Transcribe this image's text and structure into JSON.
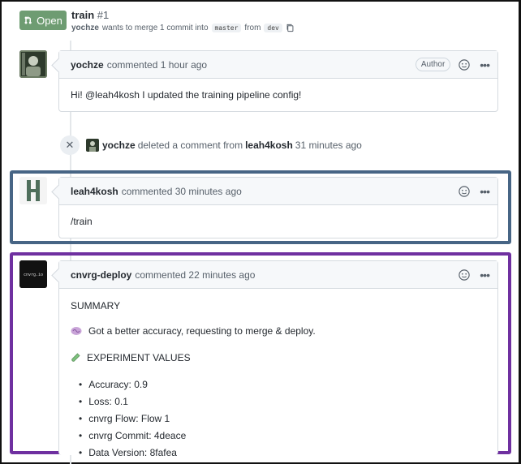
{
  "pr": {
    "status": "Open",
    "title": "train",
    "number": "#1",
    "author": "yochze",
    "merge_text": "wants to merge 1 commit into",
    "base_branch": "master",
    "from_text": "from",
    "head_branch": "dev"
  },
  "comments": [
    {
      "author": "yochze",
      "meta": "commented 1 hour ago",
      "badge": "Author",
      "body": "Hi! @leah4kosh I updated the training pipeline config!"
    },
    {
      "author": "leah4kosh",
      "meta": "commented 30 minutes ago",
      "body": "/train"
    },
    {
      "author": "cnvrg-deploy",
      "meta": "commented 22 minutes ago",
      "avatar_text": "cnvrg.io",
      "summary": "SUMMARY",
      "accuracy_line": "Got a better accuracy, requesting to merge & deploy.",
      "experiment_heading": "EXPERIMENT VALUES",
      "values": [
        "Accuracy: 0.9",
        "Loss: 0.1",
        "cnvrg Flow: Flow 1",
        "cnvrg Commit: 4deace",
        "Data Version: 8fafea"
      ]
    }
  ],
  "event": {
    "actor": "yochze",
    "text1": "deleted a comment from",
    "target": "leah4kosh",
    "time": "31 minutes ago"
  },
  "colors": {
    "open_badge": "#6e9c72",
    "highlight_blue": "#476585",
    "highlight_purple": "#6f30a0"
  },
  "icons": [
    "pull-request-icon",
    "copy-icon",
    "smiley-icon",
    "more-icon",
    "close-icon",
    "brain-icon",
    "test-tube-icon"
  ]
}
